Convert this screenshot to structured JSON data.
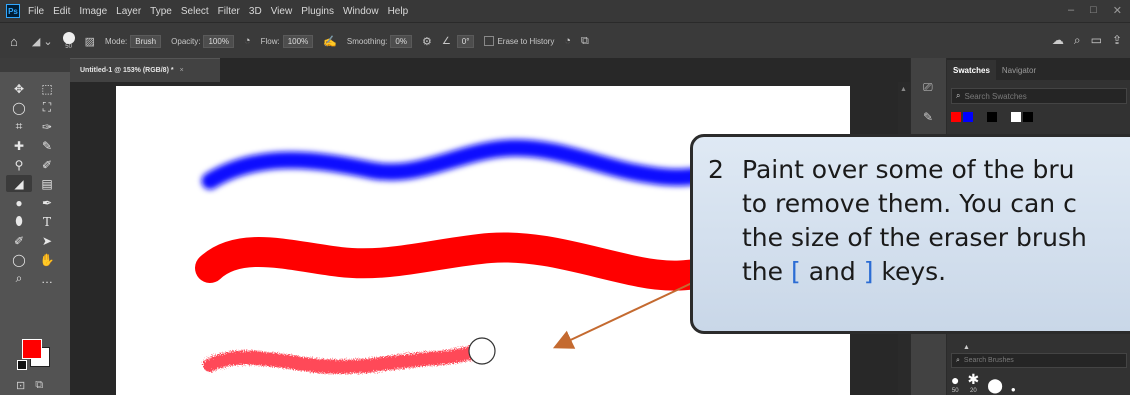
{
  "menubar": {
    "logo": "Ps",
    "items": [
      "File",
      "Edit",
      "Image",
      "Layer",
      "Type",
      "Select",
      "Filter",
      "3D",
      "View",
      "Plugins",
      "Window",
      "Help"
    ],
    "window_controls": [
      "–",
      "□",
      "✕"
    ]
  },
  "options": {
    "brush_size": "50",
    "mode_label": "Mode:",
    "mode_value": "Brush",
    "opacity_label": "Opacity:",
    "opacity_value": "100%",
    "flow_label": "Flow:",
    "flow_value": "100%",
    "smoothing_label": "Smoothing:",
    "smoothing_value": "0%",
    "angle_value": "0°",
    "erase_to_history": "Erase to History"
  },
  "document": {
    "tab_title": "Untitled-1 @ 153% (RGB/8) *",
    "tab_close": "×"
  },
  "panels": {
    "tabs": [
      "Swatches",
      "Navigator"
    ],
    "search_placeholder": "Search Swatches",
    "brush_search_placeholder": "Search Brushes",
    "brush_sizes": [
      "50",
      "20"
    ]
  },
  "colors": {
    "foreground": "#ff0000",
    "background": "#ffffff",
    "stroke_blue": "#0d10ff",
    "stroke_red": "#ff0000",
    "arrow": "#c46a30",
    "callout_fill": "#d6e2ef"
  },
  "callout": {
    "number": "2",
    "line1": "Paint over some of the bru",
    "line2": "to remove them.  You can c",
    "line3_pre": "the size of the ",
    "line3_mid": "eraser brush",
    "line4_pre": "the ",
    "key_open": "[",
    "line4_and": " and ",
    "key_close": "]",
    "line4_post": " keys."
  },
  "icons": {
    "home": "home-icon",
    "eraser": "eraser-icon",
    "search": "search-icon",
    "share": "share-icon"
  }
}
